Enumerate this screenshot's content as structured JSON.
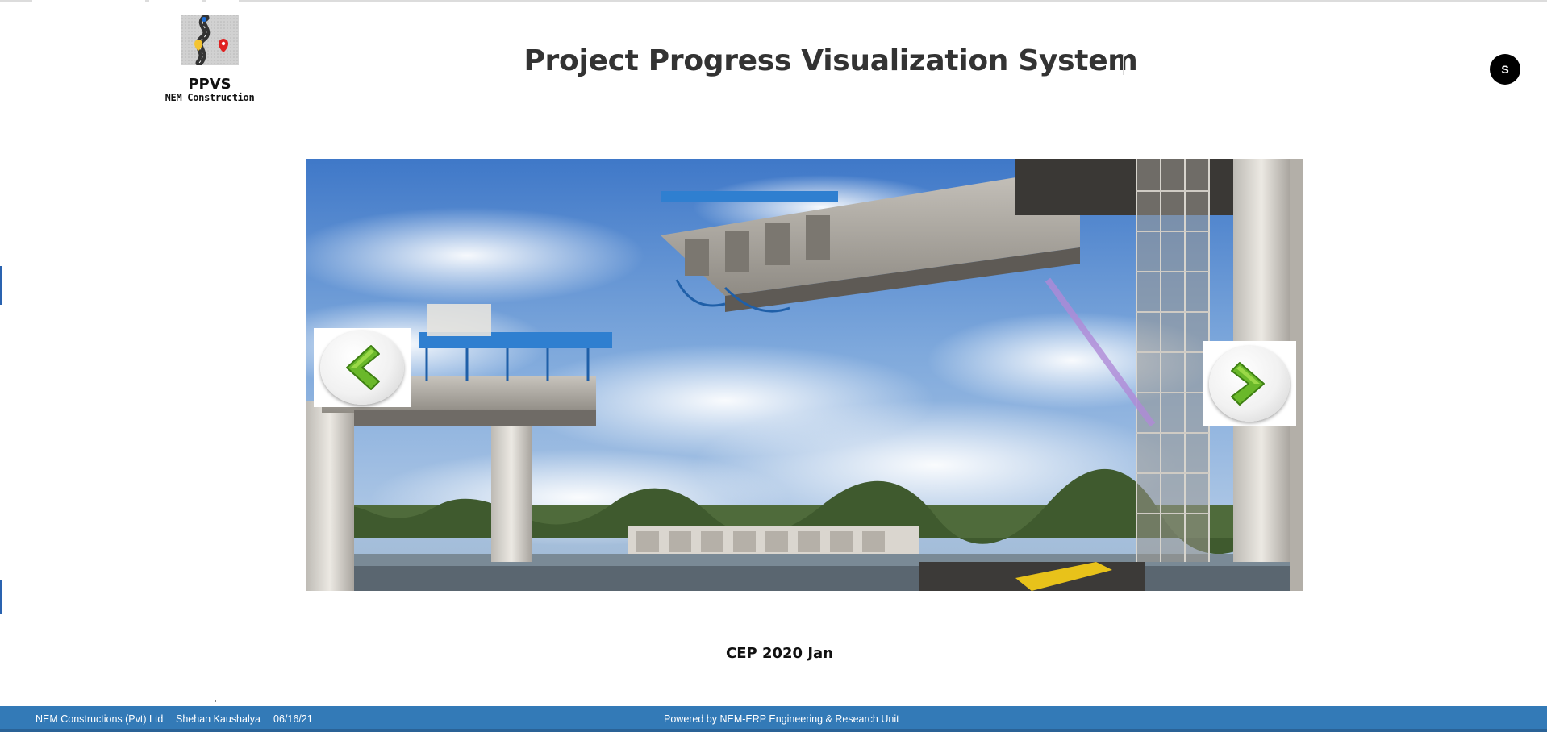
{
  "header": {
    "logo": {
      "title": "PPVS",
      "subtitle": "NEM Construction",
      "icon": "road-map-pin-icon"
    },
    "app_title": "Project Progress Visualization System",
    "user_avatar_initial": "S"
  },
  "carousel": {
    "slide_image": "bridge-construction-photo",
    "prev_icon": "green-chevron-left-icon",
    "next_icon": "green-chevron-right-icon",
    "caption": "CEP 2020 Jan"
  },
  "footer": {
    "company": "NEM Constructions (Pvt) Ltd",
    "user": "Shehan Kaushalya",
    "date": "06/16/21",
    "powered_by": "Powered by NEM-ERP Engineering & Research Unit",
    "bg_color": "#337ab7"
  }
}
